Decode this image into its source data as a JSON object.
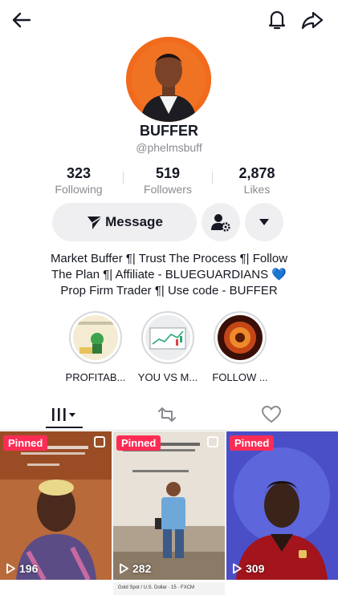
{
  "profile": {
    "username": "BUFFER",
    "handle": "@phelmsbuff",
    "stats": [
      {
        "value": "323",
        "label": "Following"
      },
      {
        "value": "519",
        "label": "Followers"
      },
      {
        "value": "2,878",
        "label": "Likes"
      }
    ],
    "bio_lines": [
      "Market Buffer ¶| Trust The Process ¶| Follow",
      "The Plan ¶| Affiliate - BLUEGUARDIANS 💙",
      "Prop Firm Trader ¶| Use code - BUFFER"
    ]
  },
  "actions": {
    "message_label": "Message"
  },
  "highlights": [
    {
      "label": "PROFITAB..."
    },
    {
      "label": "YOU VS M..."
    },
    {
      "label": "FOLLOW ..."
    }
  ],
  "videos": [
    {
      "pinned_label": "Pinned",
      "views": "196"
    },
    {
      "pinned_label": "Pinned",
      "views": "282"
    },
    {
      "pinned_label": "Pinned",
      "views": "309"
    }
  ],
  "strip_text": "Gold Spot / U.S. Dollar · 15 · FXCM",
  "colors": {
    "pinned": "#fe2c55",
    "avatar_bg": "#f26a1b",
    "accent_blue": "#3b7ddd"
  }
}
